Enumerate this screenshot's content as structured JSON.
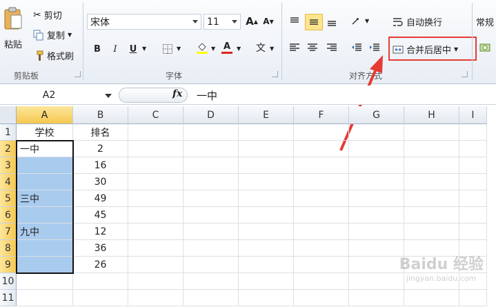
{
  "ribbon": {
    "clipboard": {
      "paste": "粘贴",
      "cut": "剪切",
      "copy": "复制",
      "format_painter": "格式刷",
      "group_label": "剪贴板"
    },
    "font": {
      "font_name": "宋体",
      "font_size": "11",
      "bold": "B",
      "italic": "I",
      "underline": "U",
      "grow": "A",
      "shrink": "A",
      "font_color": "A",
      "phonetic": "文",
      "group_label": "字体"
    },
    "alignment": {
      "wrap_text": "自动换行",
      "merge_center": "合并后居中",
      "group_label": "对齐方式"
    },
    "number": {
      "format": "常规"
    }
  },
  "formula_bar": {
    "name_box": "A2",
    "fx": "fx",
    "value": "一中"
  },
  "columns": [
    "A",
    "B",
    "C",
    "D",
    "E",
    "F",
    "G",
    "H",
    "I"
  ],
  "rows": [
    "1",
    "2",
    "3",
    "4",
    "5",
    "6",
    "7",
    "8",
    "9",
    "10",
    "11"
  ],
  "cells": {
    "A1": "学校",
    "B1": "排名",
    "A2": "一中",
    "B2": "2",
    "B3": "16",
    "B4": "30",
    "A5": "三中",
    "B5": "49",
    "B6": "45",
    "A7": "九中",
    "B7": "12",
    "B8": "36",
    "B9": "26"
  },
  "watermark": {
    "brand": "Baidu 经验",
    "url": "jingyan.baidu.com"
  },
  "colors": {
    "highlight": "#e53b33",
    "selection": "#a9cbee",
    "header_selected": "#f5c750"
  }
}
